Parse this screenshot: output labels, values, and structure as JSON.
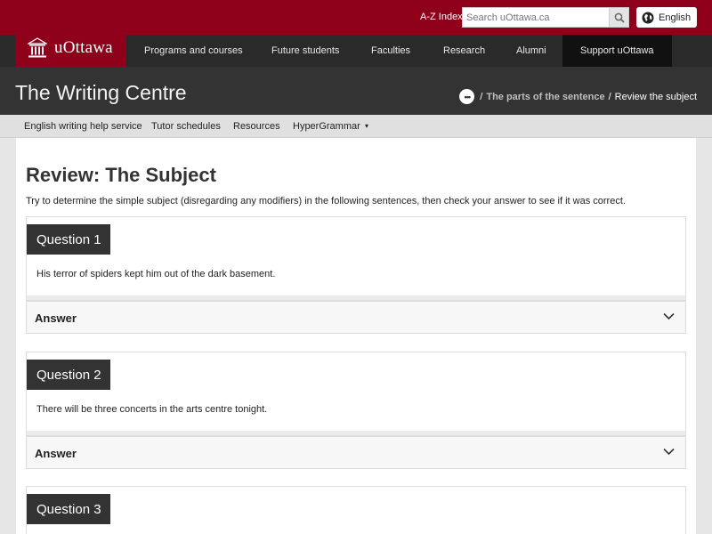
{
  "topbar": {
    "az_label": "A-Z Index",
    "search_placeholder": "Search uOttawa.ca",
    "search_icon": "magnifier-icon",
    "language_label": "English",
    "language_icon": "globe-icon"
  },
  "logo": {
    "text": "uOttawa",
    "icon": "building-icon"
  },
  "nav": {
    "items": [
      "Programs and courses",
      "Future students",
      "Faculties",
      "Research",
      "Alumni",
      "Support uOttawa"
    ]
  },
  "header": {
    "site_title": "The Writing Centre",
    "breadcrumb": {
      "parent": "The parts of the sentence",
      "current": "Review the subject",
      "separator": "/"
    }
  },
  "subnav": {
    "items": [
      "English writing help service",
      "Tutor schedules",
      "Resources",
      "HyperGrammar"
    ],
    "more_glyph": "▾"
  },
  "main": {
    "title": "Review: The Subject",
    "intro": "Try to determine the simple subject (disregarding any modifiers) in the following sentences, then check your answer to see if it was correct.",
    "questions": [
      {
        "label": "Question 1",
        "sentence": "His terror of spiders kept him out of the dark basement.",
        "answer_label": "Answer"
      },
      {
        "label": "Question 2",
        "sentence": "There will be three concerts in the arts centre tonight.",
        "answer_label": "Answer"
      },
      {
        "label": "Question 3"
      }
    ]
  },
  "colors": {
    "brand": "#8f001a",
    "nav_bg": "#2a2a2a",
    "header_bg": "#333333"
  }
}
